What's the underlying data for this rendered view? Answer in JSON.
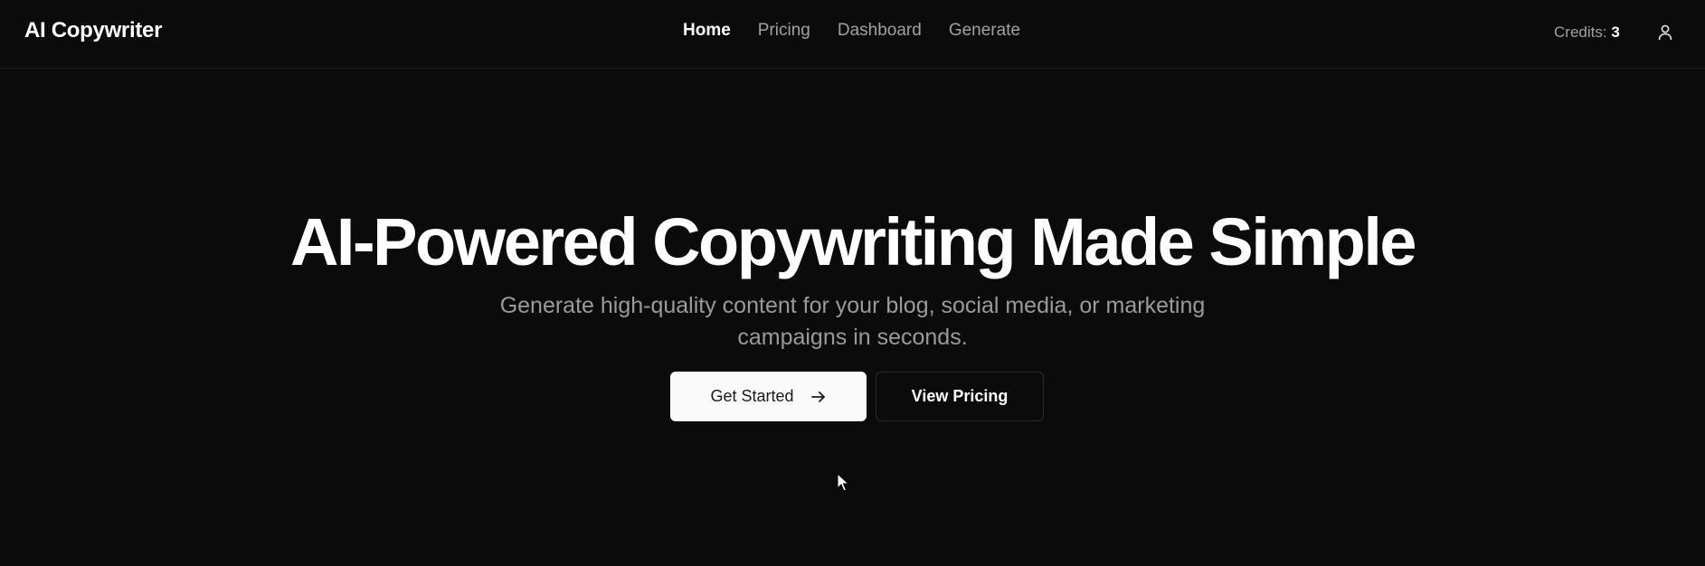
{
  "app": {
    "brand": "AI Copywriter"
  },
  "nav": {
    "items": [
      {
        "label": "Home",
        "active": true
      },
      {
        "label": "Pricing",
        "active": false
      },
      {
        "label": "Dashboard",
        "active": false
      },
      {
        "label": "Generate",
        "active": false
      }
    ]
  },
  "credits": {
    "label": "Credits:",
    "value": "3"
  },
  "user_icon": "user-icon",
  "hero": {
    "title": "AI-Powered Copywriting Made Simple",
    "subtitle": "Generate high-quality content for your blog, social media, or marketing campaigns in seconds.",
    "primary_button": "Get Started",
    "primary_button_icon": "arrow-right-icon",
    "secondary_button": "View Pricing"
  },
  "colors": {
    "background": "#0a0b0a",
    "text_primary": "#ffffff",
    "text_muted": "#a1a1a1",
    "primary_button_bg": "#fafafa",
    "primary_button_text": "#1a1a1a",
    "border": "#2a2c2a"
  }
}
